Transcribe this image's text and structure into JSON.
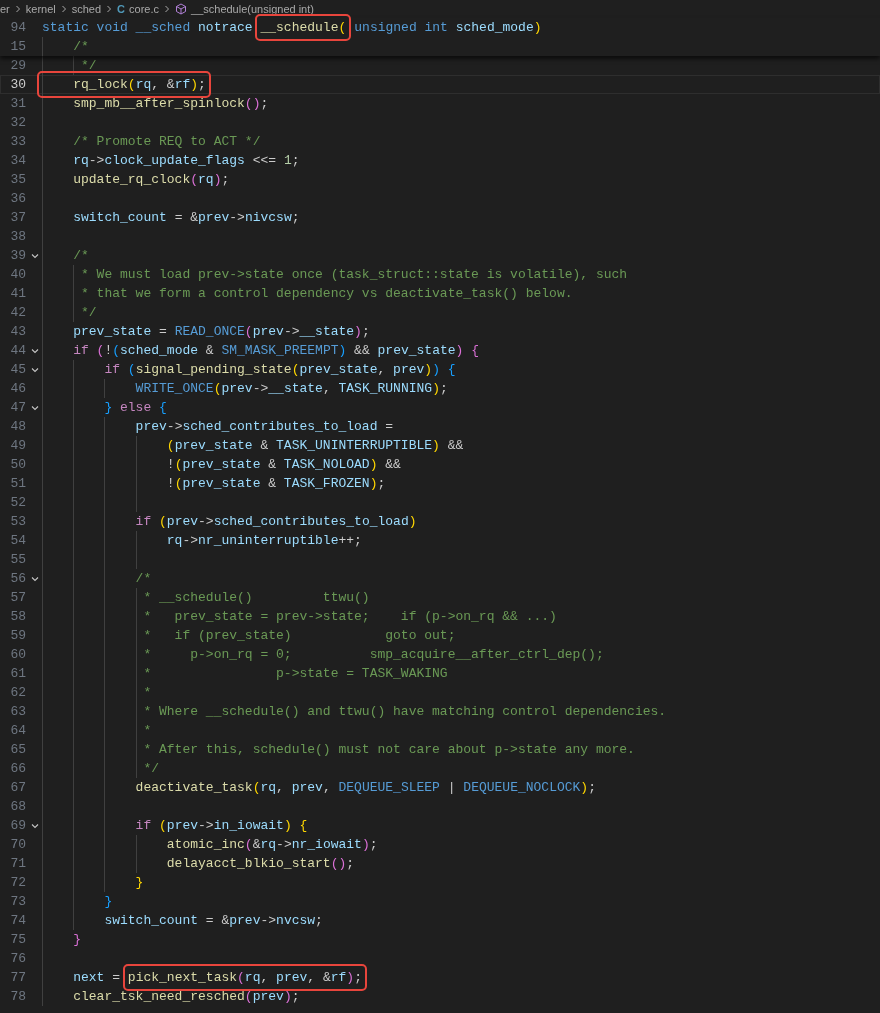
{
  "breadcrumb": [
    {
      "label": "er"
    },
    {
      "label": "kernel"
    },
    {
      "label": "sched"
    },
    {
      "label": "core.c",
      "kind": "file",
      "icon_text": "C"
    },
    {
      "label": "__schedule(unsigned int)",
      "kind": "symbol"
    }
  ],
  "sticky_lines": [
    {
      "number": "94",
      "current": false,
      "tokens": [
        {
          "kind": "keyword",
          "text": "static void __sched "
        },
        {
          "kind": "variable",
          "text": "notrace "
        }
      ],
      "boxed": [
        {
          "kind": "function",
          "text": "__schedule"
        },
        {
          "kind": "bracket1",
          "text": "("
        }
      ],
      "rest": [
        {
          "kind": "keyword",
          "text": "unsigned int "
        },
        {
          "kind": "variable",
          "text": "sched_mode"
        },
        {
          "kind": "bracket1",
          "text": ")"
        }
      ]
    },
    {
      "number": "15",
      "current": false,
      "tokens": [
        {
          "kind": "comment",
          "text": "    /*"
        }
      ]
    }
  ],
  "lines": [
    {
      "number": "29",
      "current": false,
      "tokens": [
        {
          "kind": "comment",
          "text": "     */"
        }
      ]
    },
    {
      "number": "30",
      "current": true,
      "boxed": [
        {
          "kind": "function",
          "text": "    rq_lock"
        },
        {
          "kind": "bracket1",
          "text": "("
        },
        {
          "kind": "variable",
          "text": "rq"
        },
        {
          "kind": "plain",
          "text": ", &"
        },
        {
          "kind": "variable",
          "text": "rf"
        },
        {
          "kind": "bracket1",
          "text": ")"
        },
        {
          "kind": "plain",
          "text": ";"
        }
      ]
    },
    {
      "number": "31",
      "current": false,
      "tokens": [
        {
          "kind": "function",
          "text": "    smp_mb__after_spinlock"
        },
        {
          "kind": "bracket2",
          "text": "()"
        },
        {
          "kind": "plain",
          "text": ";"
        }
      ]
    },
    {
      "number": "32",
      "current": false
    },
    {
      "number": "33",
      "current": false,
      "tokens": [
        {
          "kind": "comment",
          "text": "    /* Promote REQ to ACT */"
        }
      ]
    },
    {
      "number": "34",
      "current": false,
      "tokens": [
        {
          "kind": "variable",
          "text": "    rq"
        },
        {
          "kind": "plain",
          "text": "->"
        },
        {
          "kind": "variable",
          "text": "clock_update_flags"
        },
        {
          "kind": "plain",
          "text": " <<= "
        },
        {
          "kind": "number",
          "text": "1"
        },
        {
          "kind": "plain",
          "text": ";"
        }
      ]
    },
    {
      "number": "35",
      "current": false,
      "tokens": [
        {
          "kind": "function",
          "text": "    update_rq_clock"
        },
        {
          "kind": "bracket2",
          "text": "("
        },
        {
          "kind": "variable",
          "text": "rq"
        },
        {
          "kind": "bracket2",
          "text": ")"
        },
        {
          "kind": "plain",
          "text": ";"
        }
      ]
    },
    {
      "number": "36",
      "current": false
    },
    {
      "number": "37",
      "current": false,
      "tokens": [
        {
          "kind": "variable",
          "text": "    switch_count"
        },
        {
          "kind": "plain",
          "text": " = &"
        },
        {
          "kind": "variable",
          "text": "prev"
        },
        {
          "kind": "plain",
          "text": "->"
        },
        {
          "kind": "variable",
          "text": "nivcsw"
        },
        {
          "kind": "plain",
          "text": ";"
        }
      ]
    },
    {
      "number": "38",
      "current": false
    },
    {
      "number": "39",
      "current": false,
      "folded": false,
      "tokens": [
        {
          "kind": "comment",
          "text": "    /*"
        }
      ]
    },
    {
      "number": "40",
      "current": false,
      "tokens": [
        {
          "kind": "comment",
          "text": "     * We must load prev->state once (task_struct::state is volatile), such"
        }
      ]
    },
    {
      "number": "41",
      "current": false,
      "tokens": [
        {
          "kind": "comment",
          "text": "     * that we form a control dependency vs deactivate_task() below."
        }
      ]
    },
    {
      "number": "42",
      "current": false,
      "tokens": [
        {
          "kind": "comment",
          "text": "     */"
        }
      ]
    },
    {
      "number": "43",
      "current": false,
      "tokens": [
        {
          "kind": "variable",
          "text": "    prev_state"
        },
        {
          "kind": "plain",
          "text": " = "
        },
        {
          "kind": "macro",
          "text": "READ_ONCE"
        },
        {
          "kind": "bracket2",
          "text": "("
        },
        {
          "kind": "variable",
          "text": "prev"
        },
        {
          "kind": "plain",
          "text": "->"
        },
        {
          "kind": "variable",
          "text": "__state"
        },
        {
          "kind": "bracket2",
          "text": ")"
        },
        {
          "kind": "plain",
          "text": ";"
        }
      ]
    },
    {
      "number": "44",
      "current": false,
      "folded": false,
      "tokens": [
        {
          "kind": "control",
          "text": "    if "
        },
        {
          "kind": "bracket2",
          "text": "("
        },
        {
          "kind": "plain",
          "text": "!"
        },
        {
          "kind": "bracket3",
          "text": "("
        },
        {
          "kind": "variable",
          "text": "sched_mode"
        },
        {
          "kind": "plain",
          "text": " & "
        },
        {
          "kind": "macro",
          "text": "SM_MASK_PREEMPT"
        },
        {
          "kind": "bracket3",
          "text": ")"
        },
        {
          "kind": "plain",
          "text": " && "
        },
        {
          "kind": "variable",
          "text": "prev_state"
        },
        {
          "kind": "bracket2",
          "text": ") {"
        }
      ]
    },
    {
      "number": "45",
      "current": false,
      "folded": false,
      "tokens": [
        {
          "kind": "control",
          "text": "        if "
        },
        {
          "kind": "bracket3",
          "text": "("
        },
        {
          "kind": "function",
          "text": "signal_pending_state"
        },
        {
          "kind": "bracket1",
          "text": "("
        },
        {
          "kind": "variable",
          "text": "prev_state"
        },
        {
          "kind": "plain",
          "text": ", "
        },
        {
          "kind": "variable",
          "text": "prev"
        },
        {
          "kind": "bracket1",
          "text": ")"
        },
        {
          "kind": "bracket3",
          "text": ") {"
        }
      ]
    },
    {
      "number": "46",
      "current": false,
      "tokens": [
        {
          "kind": "macro",
          "text": "            WRITE_ONCE"
        },
        {
          "kind": "bracket1",
          "text": "("
        },
        {
          "kind": "variable",
          "text": "prev"
        },
        {
          "kind": "plain",
          "text": "->"
        },
        {
          "kind": "variable",
          "text": "__state"
        },
        {
          "kind": "plain",
          "text": ", "
        },
        {
          "kind": "variable",
          "text": "TASK_RUNNING"
        },
        {
          "kind": "bracket1",
          "text": ")"
        },
        {
          "kind": "plain",
          "text": ";"
        }
      ]
    },
    {
      "number": "47",
      "current": false,
      "folded": false,
      "tokens": [
        {
          "kind": "bracket3",
          "text": "        } "
        },
        {
          "kind": "control",
          "text": "else "
        },
        {
          "kind": "bracket3",
          "text": "{"
        }
      ]
    },
    {
      "number": "48",
      "current": false,
      "tokens": [
        {
          "kind": "variable",
          "text": "            prev"
        },
        {
          "kind": "plain",
          "text": "->"
        },
        {
          "kind": "variable",
          "text": "sched_contributes_to_load"
        },
        {
          "kind": "plain",
          "text": " ="
        }
      ]
    },
    {
      "number": "49",
      "current": false,
      "tokens": [
        {
          "kind": "bracket1",
          "text": "                ("
        },
        {
          "kind": "variable",
          "text": "prev_state"
        },
        {
          "kind": "plain",
          "text": " & "
        },
        {
          "kind": "variable",
          "text": "TASK_UNINTERRUPTIBLE"
        },
        {
          "kind": "bracket1",
          "text": ")"
        },
        {
          "kind": "plain",
          "text": " &&"
        }
      ]
    },
    {
      "number": "50",
      "current": false,
      "tokens": [
        {
          "kind": "plain",
          "text": "                !"
        },
        {
          "kind": "bracket1",
          "text": "("
        },
        {
          "kind": "variable",
          "text": "prev_state"
        },
        {
          "kind": "plain",
          "text": " & "
        },
        {
          "kind": "variable",
          "text": "TASK_NOLOAD"
        },
        {
          "kind": "bracket1",
          "text": ")"
        },
        {
          "kind": "plain",
          "text": " &&"
        }
      ]
    },
    {
      "number": "51",
      "current": false,
      "tokens": [
        {
          "kind": "plain",
          "text": "                !"
        },
        {
          "kind": "bracket1",
          "text": "("
        },
        {
          "kind": "variable",
          "text": "prev_state"
        },
        {
          "kind": "plain",
          "text": " & "
        },
        {
          "kind": "variable",
          "text": "TASK_FROZEN"
        },
        {
          "kind": "bracket1",
          "text": ")"
        },
        {
          "kind": "plain",
          "text": ";"
        }
      ]
    },
    {
      "number": "52",
      "current": false
    },
    {
      "number": "53",
      "current": false,
      "tokens": [
        {
          "kind": "control",
          "text": "            if "
        },
        {
          "kind": "bracket1",
          "text": "("
        },
        {
          "kind": "variable",
          "text": "prev"
        },
        {
          "kind": "plain",
          "text": "->"
        },
        {
          "kind": "variable",
          "text": "sched_contributes_to_load"
        },
        {
          "kind": "bracket1",
          "text": ")"
        }
      ]
    },
    {
      "number": "54",
      "current": false,
      "tokens": [
        {
          "kind": "variable",
          "text": "                rq"
        },
        {
          "kind": "plain",
          "text": "->"
        },
        {
          "kind": "variable",
          "text": "nr_uninterruptible"
        },
        {
          "kind": "plain",
          "text": "++;"
        }
      ]
    },
    {
      "number": "55",
      "current": false
    },
    {
      "number": "56",
      "current": false,
      "folded": false,
      "tokens": [
        {
          "kind": "comment",
          "text": "            /*"
        }
      ]
    },
    {
      "number": "57",
      "current": false,
      "tokens": [
        {
          "kind": "comment",
          "text": "             * __schedule()         ttwu()"
        }
      ]
    },
    {
      "number": "58",
      "current": false,
      "tokens": [
        {
          "kind": "comment",
          "text": "             *   prev_state = prev->state;    if (p->on_rq && ...)"
        }
      ]
    },
    {
      "number": "59",
      "current": false,
      "tokens": [
        {
          "kind": "comment",
          "text": "             *   if (prev_state)            goto out;"
        }
      ]
    },
    {
      "number": "60",
      "current": false,
      "tokens": [
        {
          "kind": "comment",
          "text": "             *     p->on_rq = 0;          smp_acquire__after_ctrl_dep();"
        }
      ]
    },
    {
      "number": "61",
      "current": false,
      "tokens": [
        {
          "kind": "comment",
          "text": "             *                p->state = TASK_WAKING"
        }
      ]
    },
    {
      "number": "62",
      "current": false,
      "tokens": [
        {
          "kind": "comment",
          "text": "             *"
        }
      ]
    },
    {
      "number": "63",
      "current": false,
      "tokens": [
        {
          "kind": "comment",
          "text": "             * Where __schedule() and ttwu() have matching control dependencies."
        }
      ]
    },
    {
      "number": "64",
      "current": false,
      "tokens": [
        {
          "kind": "comment",
          "text": "             *"
        }
      ]
    },
    {
      "number": "65",
      "current": false,
      "tokens": [
        {
          "kind": "comment",
          "text": "             * After this, schedule() must not care about p->state any more."
        }
      ]
    },
    {
      "number": "66",
      "current": false,
      "tokens": [
        {
          "kind": "comment",
          "text": "             */"
        }
      ]
    },
    {
      "number": "67",
      "current": false,
      "tokens": [
        {
          "kind": "function",
          "text": "            deactivate_task"
        },
        {
          "kind": "bracket1",
          "text": "("
        },
        {
          "kind": "variable",
          "text": "rq"
        },
        {
          "kind": "plain",
          "text": ", "
        },
        {
          "kind": "variable",
          "text": "prev"
        },
        {
          "kind": "plain",
          "text": ", "
        },
        {
          "kind": "macro",
          "text": "DEQUEUE_SLEEP"
        },
        {
          "kind": "plain",
          "text": " | "
        },
        {
          "kind": "macro",
          "text": "DEQUEUE_NOCLOCK"
        },
        {
          "kind": "bracket1",
          "text": ")"
        },
        {
          "kind": "plain",
          "text": ";"
        }
      ]
    },
    {
      "number": "68",
      "current": false
    },
    {
      "number": "69",
      "current": false,
      "folded": false,
      "tokens": [
        {
          "kind": "control",
          "text": "            if "
        },
        {
          "kind": "bracket1",
          "text": "("
        },
        {
          "kind": "variable",
          "text": "prev"
        },
        {
          "kind": "plain",
          "text": "->"
        },
        {
          "kind": "variable",
          "text": "in_iowait"
        },
        {
          "kind": "bracket1",
          "text": ") {"
        }
      ]
    },
    {
      "number": "70",
      "current": false,
      "tokens": [
        {
          "kind": "function",
          "text": "                atomic_inc"
        },
        {
          "kind": "bracket2",
          "text": "("
        },
        {
          "kind": "plain",
          "text": "&"
        },
        {
          "kind": "variable",
          "text": "rq"
        },
        {
          "kind": "plain",
          "text": "->"
        },
        {
          "kind": "variable",
          "text": "nr_iowait"
        },
        {
          "kind": "bracket2",
          "text": ")"
        },
        {
          "kind": "plain",
          "text": ";"
        }
      ]
    },
    {
      "number": "71",
      "current": false,
      "tokens": [
        {
          "kind": "function",
          "text": "                delayacct_blkio_start"
        },
        {
          "kind": "bracket2",
          "text": "()"
        },
        {
          "kind": "plain",
          "text": ";"
        }
      ]
    },
    {
      "number": "72",
      "current": false,
      "tokens": [
        {
          "kind": "bracket1",
          "text": "            }"
        }
      ]
    },
    {
      "number": "73",
      "current": false,
      "tokens": [
        {
          "kind": "bracket3",
          "text": "        }"
        }
      ]
    },
    {
      "number": "74",
      "current": false,
      "tokens": [
        {
          "kind": "variable",
          "text": "        switch_count"
        },
        {
          "kind": "plain",
          "text": " = &"
        },
        {
          "kind": "variable",
          "text": "prev"
        },
        {
          "kind": "plain",
          "text": "->"
        },
        {
          "kind": "variable",
          "text": "nvcsw"
        },
        {
          "kind": "plain",
          "text": ";"
        }
      ]
    },
    {
      "number": "75",
      "current": false,
      "tokens": [
        {
          "kind": "bracket2",
          "text": "    }"
        }
      ]
    },
    {
      "number": "76",
      "current": false
    },
    {
      "number": "77",
      "current": false,
      "tokens": [
        {
          "kind": "variable",
          "text": "    next"
        },
        {
          "kind": "plain",
          "text": " = "
        }
      ],
      "boxed": [
        {
          "kind": "function",
          "text": "pick_next_task"
        },
        {
          "kind": "bracket2",
          "text": "("
        },
        {
          "kind": "variable",
          "text": "rq"
        },
        {
          "kind": "plain",
          "text": ", "
        },
        {
          "kind": "variable",
          "text": "prev"
        },
        {
          "kind": "plain",
          "text": ", &"
        },
        {
          "kind": "variable",
          "text": "rf"
        },
        {
          "kind": "bracket2",
          "text": ")"
        },
        {
          "kind": "plain",
          "text": ";"
        }
      ]
    },
    {
      "number": "78",
      "current": false,
      "tokens": [
        {
          "kind": "function",
          "text": "    clear_tsk_need_resched"
        },
        {
          "kind": "bracket2",
          "text": "("
        },
        {
          "kind": "variable",
          "text": "prev"
        },
        {
          "kind": "bracket2",
          "text": ")"
        },
        {
          "kind": "plain",
          "text": ";"
        }
      ]
    }
  ]
}
